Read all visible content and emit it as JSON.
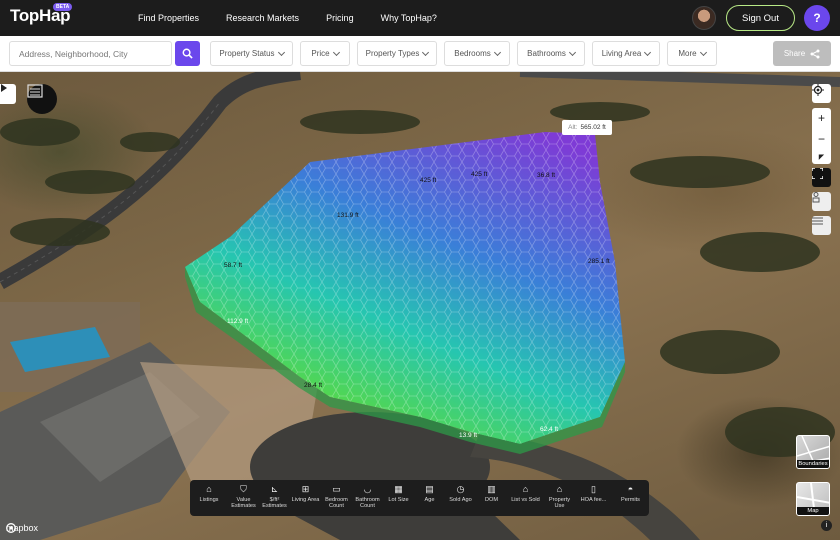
{
  "nav": {
    "logo": "TopHap",
    "beta": "BETA",
    "links": [
      "Find Properties",
      "Research Markets",
      "Pricing",
      "Why TopHap?"
    ],
    "sign_out": "Sign Out",
    "help": "?"
  },
  "filters": {
    "search_placeholder": "Address, Neighborhood, City",
    "chips": [
      "Property Status",
      "Price",
      "Property Types",
      "Bedrooms",
      "Bathrooms",
      "Living Area",
      "More"
    ],
    "share": "Share"
  },
  "map": {
    "altitude_label": "Alt:",
    "altitude_value": "565.02 ft",
    "elevation_labels": [
      "425 ft",
      "425 ft",
      "36.8 ft",
      "131.9 ft",
      "58.7 ft",
      "285.1 ft",
      "112.9 ft",
      "28.4 ft",
      "13.9 ft",
      "62.4 ft"
    ],
    "attribution": "mapbox",
    "thumbnails": [
      "Boundaries",
      "Map"
    ]
  },
  "toolbar": {
    "items": [
      "Listings",
      "Value Estimates",
      "$/ft² Estimates",
      "Living Area",
      "Bedroom Count",
      "Bathroom Count",
      "Lot Size",
      "Age",
      "Sold Ago",
      "DOM",
      "List vs Sold",
      "Property Use",
      "HOA fee...",
      "Permits"
    ]
  },
  "colors": {
    "accent": "#6b47ec",
    "signout_border": "#b8e986",
    "hex_top": "#7e3bd6",
    "hex_mid": "#26c6b0",
    "hex_bottom": "#7be34a"
  }
}
